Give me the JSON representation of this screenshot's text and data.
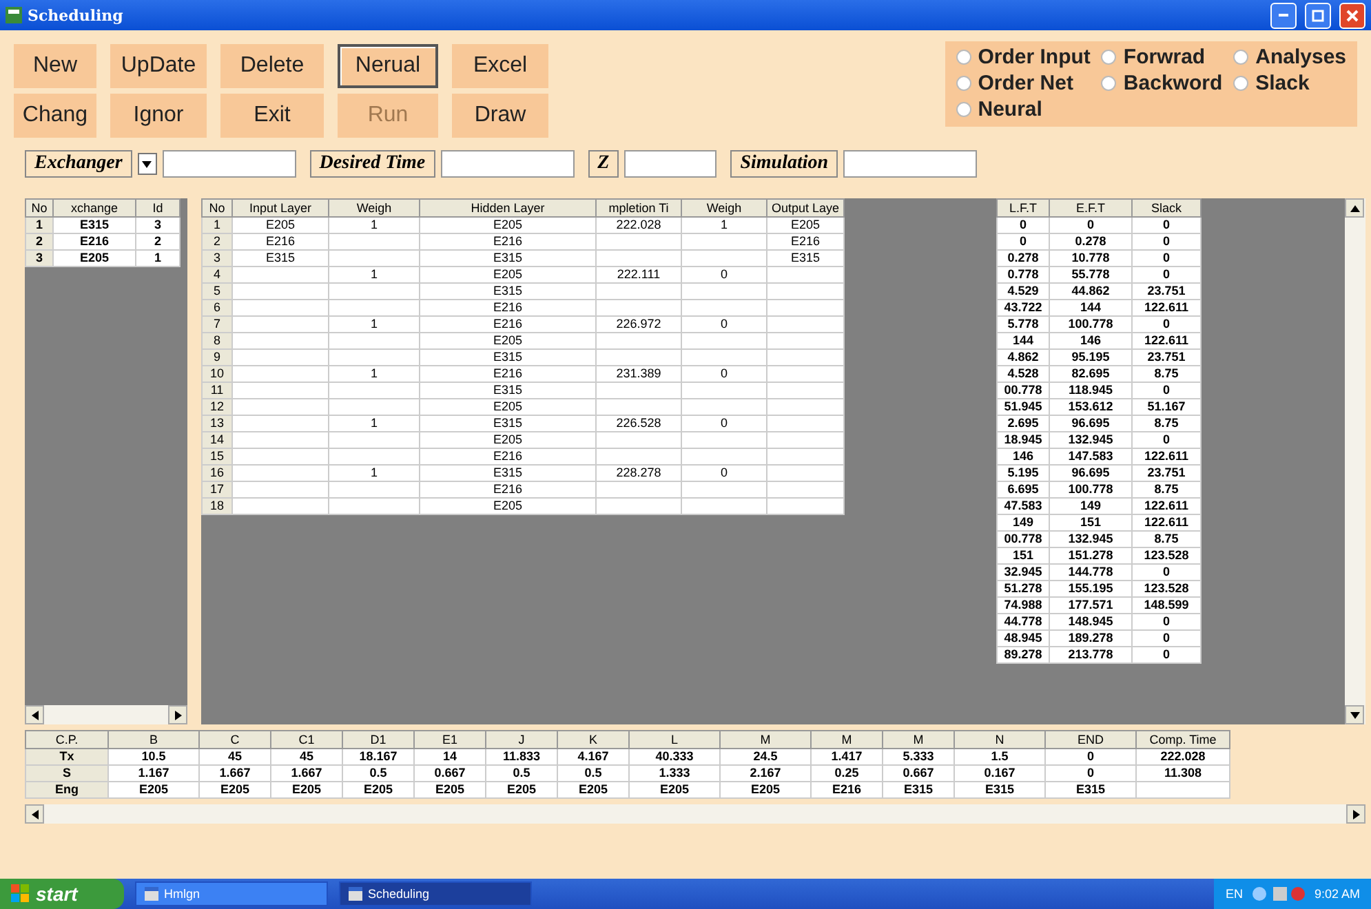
{
  "window": {
    "title": "Scheduling"
  },
  "buttons": [
    [
      {
        "label": "New",
        "focused": false,
        "disabled": false
      },
      {
        "label": "UpDate",
        "focused": false,
        "disabled": false
      },
      {
        "label": "Delete",
        "focused": false,
        "disabled": false
      },
      {
        "label": "Nerual",
        "focused": true,
        "disabled": false
      },
      {
        "label": "Excel",
        "focused": false,
        "disabled": false
      }
    ],
    [
      {
        "label": "Chang",
        "focused": false,
        "disabled": false
      },
      {
        "label": "Ignor",
        "focused": false,
        "disabled": false
      },
      {
        "label": "Exit",
        "focused": false,
        "disabled": false
      },
      {
        "label": "Run",
        "focused": false,
        "disabled": true
      },
      {
        "label": "Draw",
        "focused": false,
        "disabled": false
      }
    ]
  ],
  "options": [
    {
      "label": "Order Input",
      "selected": false
    },
    {
      "label": "Forwrad",
      "selected": false
    },
    {
      "label": "Analyses",
      "selected": false
    },
    {
      "label": "Order Net",
      "selected": false
    },
    {
      "label": "Backword",
      "selected": false
    },
    {
      "label": "Slack",
      "selected": false
    },
    {
      "label": "Neural",
      "selected": false
    }
  ],
  "fields": [
    {
      "label": "Exchanger",
      "dropdown": true
    },
    {
      "label": "Desired Time",
      "dropdown": false
    },
    {
      "label": "Z",
      "dropdown": false
    },
    {
      "label": "Simulation",
      "dropdown": false
    }
  ],
  "exchangers": {
    "columns": [
      "No",
      "xchange",
      "Id"
    ],
    "rows": [
      [
        "1",
        "E315",
        "3"
      ],
      [
        "2",
        "E216",
        "2"
      ],
      [
        "3",
        "E205",
        "1"
      ]
    ]
  },
  "network": {
    "columns": [
      "No",
      "Input Layer",
      "Weigh",
      "Hidden Layer",
      "mpletion Ti",
      "Weigh",
      "Output Laye"
    ],
    "rows": [
      [
        "1",
        "E205",
        "1",
        "E205",
        "222.028",
        "1",
        "E205"
      ],
      [
        "2",
        "E216",
        "",
        "E216",
        "",
        "",
        "E216"
      ],
      [
        "3",
        "E315",
        "",
        "E315",
        "",
        "",
        "E315"
      ],
      [
        "4",
        "",
        "1",
        "E205",
        "222.111",
        "0",
        ""
      ],
      [
        "5",
        "",
        "",
        "E315",
        "",
        "",
        ""
      ],
      [
        "6",
        "",
        "",
        "E216",
        "",
        "",
        ""
      ],
      [
        "7",
        "",
        "1",
        "E216",
        "226.972",
        "0",
        ""
      ],
      [
        "8",
        "",
        "",
        "E205",
        "",
        "",
        ""
      ],
      [
        "9",
        "",
        "",
        "E315",
        "",
        "",
        ""
      ],
      [
        "10",
        "",
        "1",
        "E216",
        "231.389",
        "0",
        ""
      ],
      [
        "11",
        "",
        "",
        "E315",
        "",
        "",
        ""
      ],
      [
        "12",
        "",
        "",
        "E205",
        "",
        "",
        ""
      ],
      [
        "13",
        "",
        "1",
        "E315",
        "226.528",
        "0",
        ""
      ],
      [
        "14",
        "",
        "",
        "E205",
        "",
        "",
        ""
      ],
      [
        "15",
        "",
        "",
        "E216",
        "",
        "",
        ""
      ],
      [
        "16",
        "",
        "1",
        "E315",
        "228.278",
        "0",
        ""
      ],
      [
        "17",
        "",
        "",
        "E216",
        "",
        "",
        ""
      ],
      [
        "18",
        "",
        "",
        "E205",
        "",
        "",
        ""
      ]
    ]
  },
  "times": {
    "columns": [
      "L.F.T",
      "E.F.T",
      "Slack"
    ],
    "rows": [
      [
        "0",
        "0",
        "0"
      ],
      [
        "0",
        "0.278",
        "0"
      ],
      [
        "0.278",
        "10.778",
        "0"
      ],
      [
        "0.778",
        "55.778",
        "0"
      ],
      [
        "4.529",
        "44.862",
        "23.751"
      ],
      [
        "43.722",
        "144",
        "122.611"
      ],
      [
        "5.778",
        "100.778",
        "0"
      ],
      [
        "144",
        "146",
        "122.611"
      ],
      [
        "4.862",
        "95.195",
        "23.751"
      ],
      [
        "4.528",
        "82.695",
        "8.75"
      ],
      [
        "00.778",
        "118.945",
        "0"
      ],
      [
        "51.945",
        "153.612",
        "51.167"
      ],
      [
        "2.695",
        "96.695",
        "8.75"
      ],
      [
        "18.945",
        "132.945",
        "0"
      ],
      [
        "146",
        "147.583",
        "122.611"
      ],
      [
        "5.195",
        "96.695",
        "23.751"
      ],
      [
        "6.695",
        "100.778",
        "8.75"
      ],
      [
        "47.583",
        "149",
        "122.611"
      ],
      [
        "149",
        "151",
        "122.611"
      ],
      [
        "00.778",
        "132.945",
        "8.75"
      ],
      [
        "151",
        "151.278",
        "123.528"
      ],
      [
        "32.945",
        "144.778",
        "0"
      ],
      [
        "51.278",
        "155.195",
        "123.528"
      ],
      [
        "74.988",
        "177.571",
        "148.599"
      ],
      [
        "44.778",
        "148.945",
        "0"
      ],
      [
        "48.945",
        "189.278",
        "0"
      ],
      [
        "89.278",
        "213.778",
        "0"
      ]
    ]
  },
  "critical_path": {
    "columns": [
      "C.P.",
      "B",
      "C",
      "C1",
      "D1",
      "E1",
      "J",
      "K",
      "L",
      "M",
      "M",
      "M",
      "N",
      "END",
      "Comp. Time"
    ],
    "rows": [
      [
        "Tx",
        "10.5",
        "45",
        "45",
        "18.167",
        "14",
        "11.833",
        "4.167",
        "40.333",
        "24.5",
        "1.417",
        "5.333",
        "1.5",
        "0",
        "222.028"
      ],
      [
        "S",
        "1.167",
        "1.667",
        "1.667",
        "0.5",
        "0.667",
        "0.5",
        "0.5",
        "1.333",
        "2.167",
        "0.25",
        "0.667",
        "0.167",
        "0",
        "11.308"
      ],
      [
        "Eng",
        "E205",
        "E205",
        "E205",
        "E205",
        "E205",
        "E205",
        "E205",
        "E205",
        "E205",
        "E216",
        "E315",
        "E315",
        "E315",
        ""
      ]
    ]
  },
  "taskbar": {
    "start": "start",
    "tasks": [
      {
        "label": "Hmlgn",
        "selected": false
      },
      {
        "label": "Scheduling",
        "selected": true
      }
    ],
    "language": "EN",
    "clock": "9:02 AM"
  }
}
